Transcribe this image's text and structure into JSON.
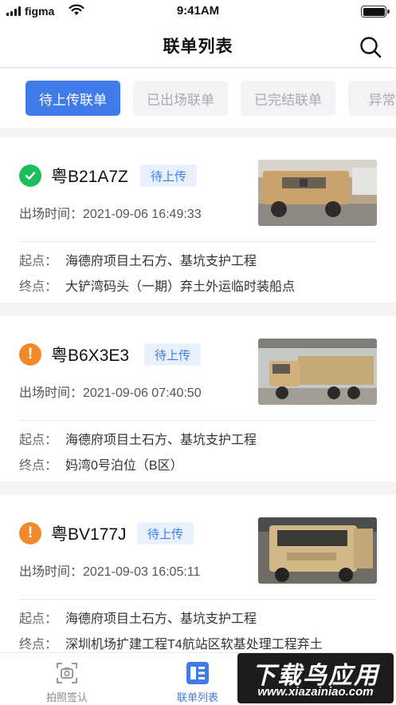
{
  "status_bar": {
    "carrier": "figma",
    "time": "9:41AM"
  },
  "nav": {
    "title": "联单列表",
    "search_icon": "search-icon"
  },
  "tabs": [
    {
      "label": "待上传联单",
      "active": true
    },
    {
      "label": "已出场联单",
      "active": false
    },
    {
      "label": "已完结联单",
      "active": false
    },
    {
      "label": "异常联单",
      "active": false
    }
  ],
  "list_labels": {
    "exit_time": "出场时间：",
    "start": "起点：",
    "end": "终点："
  },
  "cards": [
    {
      "status": "ok",
      "status_icon": "check-circle-icon",
      "plate": "粤B21A7Z",
      "badge": "待上传",
      "exit_time": "2021-09-06 16:49:33",
      "start": "海德府项目土石方、基坑支护工程",
      "end": "大铲湾码头（一期）弃土外运临时装船点"
    },
    {
      "status": "warn",
      "status_icon": "exclamation-circle-icon",
      "plate": "粤B6X3E3",
      "badge": "待上传",
      "exit_time": "2021-09-06 07:40:50",
      "start": "海德府项目土石方、基坑支护工程",
      "end": "妈湾0号泊位（B区）"
    },
    {
      "status": "warn",
      "status_icon": "exclamation-circle-icon",
      "plate": "粤BV177J",
      "badge": "待上传",
      "exit_time": "2021-09-03 16:05:11",
      "start": "海德府项目土石方、基坑支护工程",
      "end": "深圳机场扩建工程T4航站区软基处理工程弃土"
    }
  ],
  "tabbar": [
    {
      "label": "拍照签认",
      "icon": "camera-scan-icon",
      "active": false
    },
    {
      "label": "联单列表",
      "icon": "list-icon",
      "active": true
    }
  ],
  "watermark": {
    "title": "下载鸟应用",
    "url": "www.xiazainiao.com"
  },
  "colors": {
    "accent": "#3f7ce9",
    "ok": "#1ebd5c",
    "warn": "#f08a2b",
    "badge_bg": "#e8f0fd"
  }
}
